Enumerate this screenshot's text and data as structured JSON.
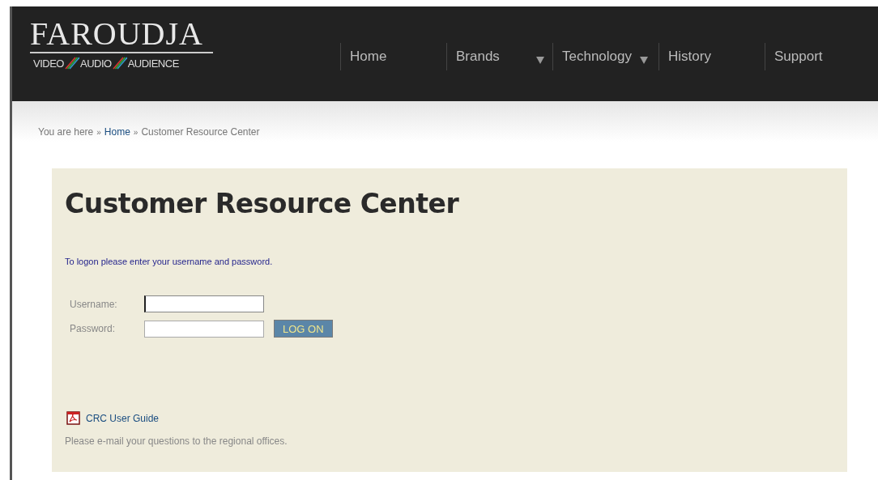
{
  "logo": {
    "name": "FAROUDJA",
    "tagline": [
      "VIDEO",
      "AUDIO",
      "AUDIENCE"
    ]
  },
  "nav": [
    {
      "label": "Home",
      "dropdown": false
    },
    {
      "label": "Brands",
      "dropdown": true
    },
    {
      "label": "Technology",
      "dropdown": true
    },
    {
      "label": "History",
      "dropdown": false
    },
    {
      "label": "Support",
      "dropdown": false
    }
  ],
  "breadcrumb": {
    "prefix": "You are here",
    "separator": "»",
    "items": [
      {
        "label": "Home",
        "link": true
      },
      {
        "label": "Customer Resource Center",
        "link": false
      }
    ]
  },
  "panel": {
    "title": "Customer Resource Center",
    "instructions": "To logon please enter your username and password.",
    "fields": [
      {
        "label": "Username:",
        "focused": true
      },
      {
        "label": "Password:",
        "focused": false
      }
    ],
    "button": "LOG ON",
    "guide_link": "CRC User Guide",
    "note": "Please e-mail your questions to the regional offices."
  }
}
